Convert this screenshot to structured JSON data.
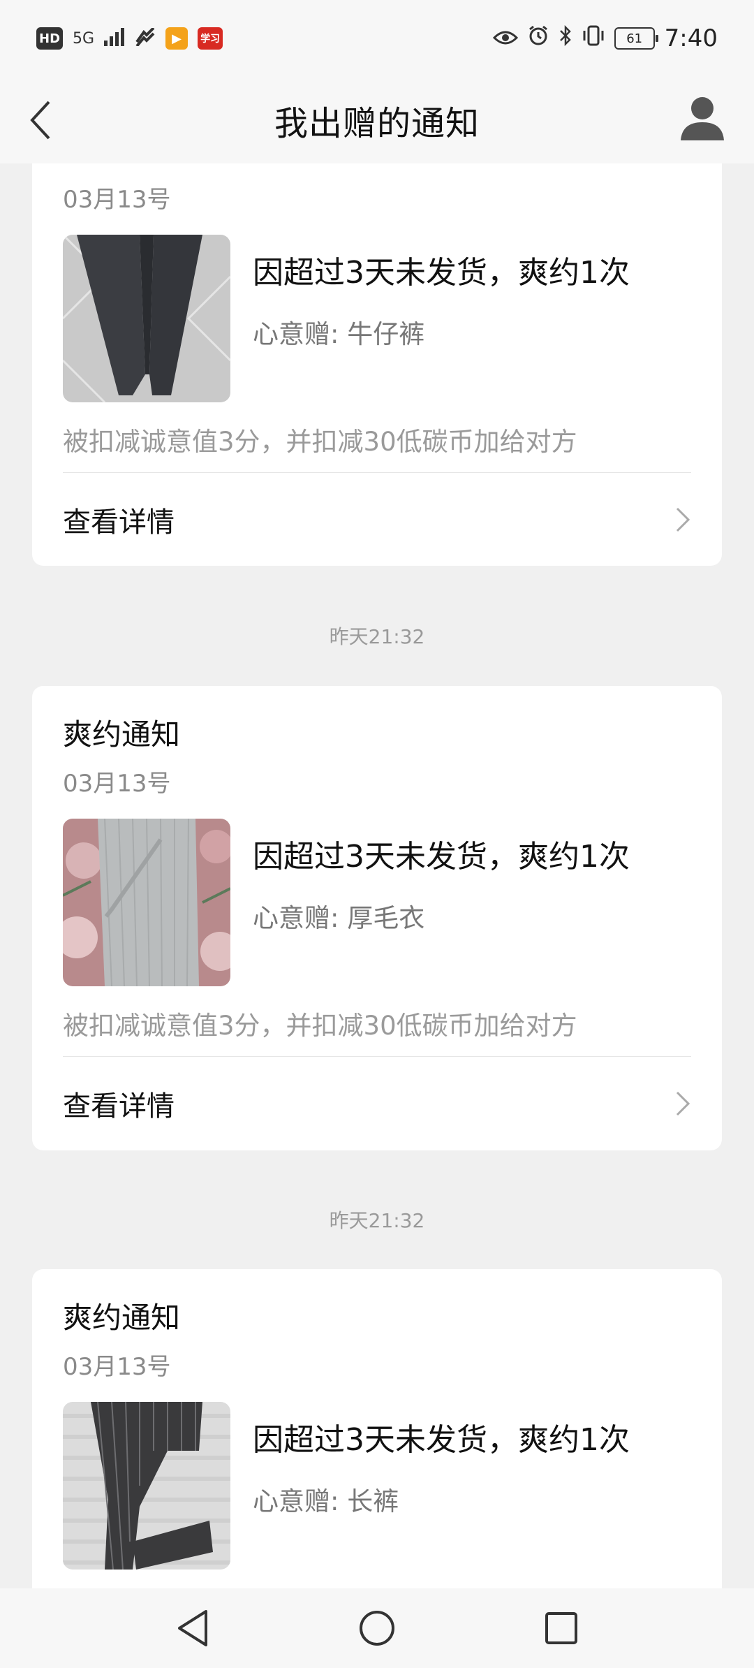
{
  "status_bar": {
    "hd": "HD",
    "network": "5G",
    "app_badge_red": "学习",
    "battery": "61",
    "time": "7:40"
  },
  "header": {
    "title": "我出赠的通知"
  },
  "timestamps": [
    "昨天21:32",
    "昨天21:32"
  ],
  "cards": [
    {
      "date": "03月13号",
      "notice": "因超过3天未发货，爽约1次",
      "gift": "心意赠: 牛仔裤",
      "penalty": "被扣减诚意值3分，并扣减30低碳币加给对方",
      "detail_label": "查看详情"
    },
    {
      "title": "爽约通知",
      "date": "03月13号",
      "notice": "因超过3天未发货，爽约1次",
      "gift": "心意赠: 厚毛衣",
      "penalty": "被扣减诚意值3分，并扣减30低碳币加给对方",
      "detail_label": "查看详情"
    },
    {
      "title": "爽约通知",
      "date": "03月13号",
      "notice": "因超过3天未发货，爽约1次",
      "gift": "心意赠: 长裤"
    }
  ],
  "icons": {
    "back": "back-arrow-icon",
    "avatar": "user-avatar-icon",
    "chevron": "chevron-right-icon",
    "nav_back": "nav-back-icon",
    "nav_home": "nav-home-icon",
    "nav_recent": "nav-recent-icon"
  }
}
